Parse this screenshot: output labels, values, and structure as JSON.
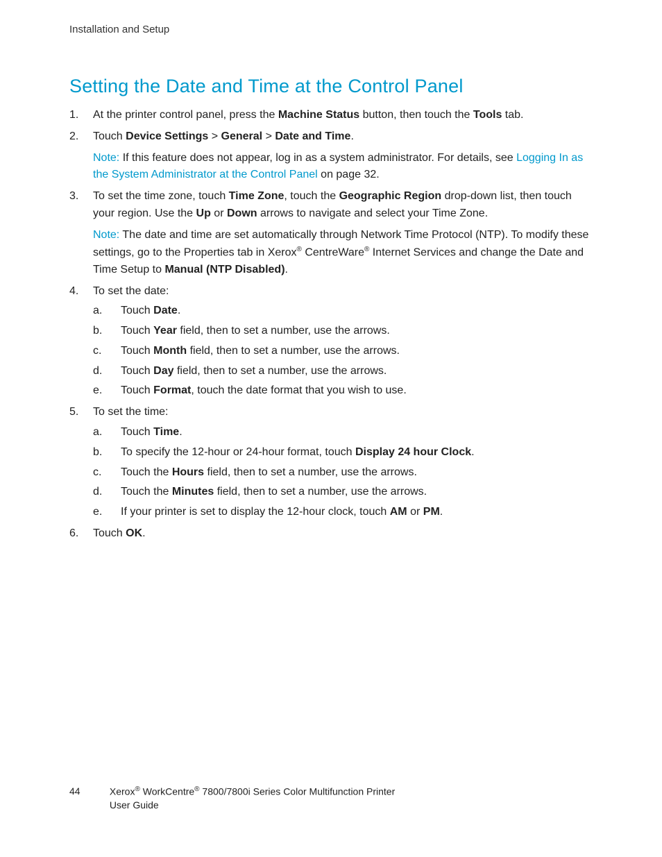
{
  "header": {
    "section": "Installation and Setup"
  },
  "title": "Setting the Date and Time at the Control Panel",
  "steps": {
    "s1": {
      "pre": "At the printer control panel, press the ",
      "b1": "Machine Status",
      "mid": " button, then touch the ",
      "b2": "Tools",
      "post": " tab."
    },
    "s2": {
      "pre": "Touch ",
      "b1": "Device Settings",
      "gt1": " > ",
      "b2": "General",
      "gt2": " > ",
      "b3": "Date and Time",
      "post": ".",
      "note_label": "Note:",
      "note_pre": " If this feature does not appear, log in as a system administrator. For details, see ",
      "note_link": "Logging In as the System Administrator at the Control Panel",
      "note_post": " on page 32."
    },
    "s3": {
      "pre": "To set the time zone, touch ",
      "b1": "Time Zone",
      "mid1": ", touch the ",
      "b2": "Geographic Region",
      "mid2": " drop-down list, then touch your region. Use the ",
      "b3": "Up",
      "mid3": " or ",
      "b4": "Down",
      "post": " arrows to navigate and select your Time Zone.",
      "note_label": "Note:",
      "note_pre": " The date and time are set automatically through Network Time Protocol (NTP). To modify these settings, go to the Properties tab in Xerox",
      "note_mid1": " CentreWare",
      "note_mid2": " Internet Services and change the Date and Time Setup to ",
      "note_b": "Manual (NTP Disabled)",
      "note_post": "."
    },
    "s4": {
      "intro": "To set the date:",
      "a": {
        "pre": "Touch ",
        "b": "Date",
        "post": "."
      },
      "b": {
        "pre": "Touch ",
        "b": "Year",
        "post": " field, then to set a number, use the arrows."
      },
      "c": {
        "pre": "Touch ",
        "b": "Month",
        "post": " field, then to set a number, use the arrows."
      },
      "d": {
        "pre": "Touch ",
        "b": "Day",
        "post": " field, then to set a number, use the arrows."
      },
      "e": {
        "pre": "Touch ",
        "b": "Format",
        "post": ", touch the date format that you wish to use."
      }
    },
    "s5": {
      "intro": "To set the time:",
      "a": {
        "pre": "Touch ",
        "b": "Time",
        "post": "."
      },
      "b": {
        "pre": "To specify the 12-hour or 24-hour format, touch ",
        "b": "Display 24 hour Clock",
        "post": "."
      },
      "c": {
        "pre": "Touch the ",
        "b": "Hours",
        "post": " field, then to set a number, use the arrows."
      },
      "d": {
        "pre": "Touch the ",
        "b": "Minutes",
        "post": " field, then to set a number, use the arrows."
      },
      "e": {
        "pre": "If your printer is set to display the 12-hour clock, touch ",
        "b1": "AM",
        "mid": " or ",
        "b2": "PM",
        "post": "."
      }
    },
    "s6": {
      "pre": "Touch ",
      "b": "OK",
      "post": "."
    }
  },
  "footer": {
    "page": "44",
    "line1_pre": "Xerox",
    "line1_mid": " WorkCentre",
    "line1_post": " 7800/7800i Series Color Multifunction Printer",
    "line2": "User Guide",
    "reg": "®"
  }
}
